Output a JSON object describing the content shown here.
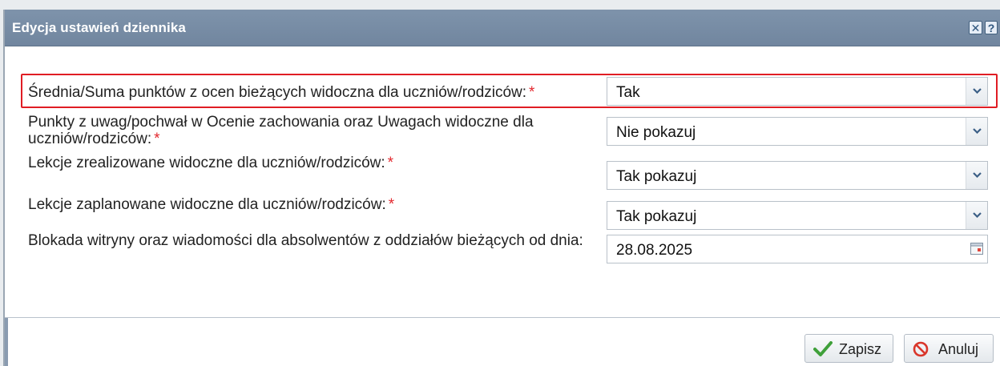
{
  "dialog": {
    "title": "Edycja ustawień dziennika",
    "close_icon_glyph": "✕",
    "help_icon_glyph": "?"
  },
  "fields": [
    {
      "label": "Średnia/Suma punktów z ocen bieżących widoczna dla uczniów/rodziców:",
      "required_marker": "*",
      "value": "Tak",
      "control": "dropdown"
    },
    {
      "label": "Punkty z uwag/pochwał w Ocenie zachowania oraz Uwagach widoczne dla uczniów/rodziców:",
      "required_marker": "*",
      "value": "Nie pokazuj",
      "control": "dropdown"
    },
    {
      "label": "Lekcje zrealizowane widoczne dla uczniów/rodziców:",
      "required_marker": "*",
      "value": "Tak pokazuj",
      "control": "dropdown"
    },
    {
      "label": "Lekcje zaplanowane widoczne dla uczniów/rodziców:",
      "required_marker": "*",
      "value": "Tak pokazuj",
      "control": "dropdown"
    },
    {
      "label": "Blokada witryny oraz wiadomości dla absolwentów z oddziałów bieżących od dnia:",
      "value": "28.08.2025",
      "control": "date"
    }
  ],
  "buttons": {
    "save_label": "Zapisz",
    "cancel_label": "Anuluj"
  },
  "colors": {
    "titlebar": "#778ca5",
    "highlight_border": "#e01d24",
    "required_marker": "#e3282e",
    "save_icon": "#3fa03a",
    "cancel_icon": "#d9362b"
  }
}
